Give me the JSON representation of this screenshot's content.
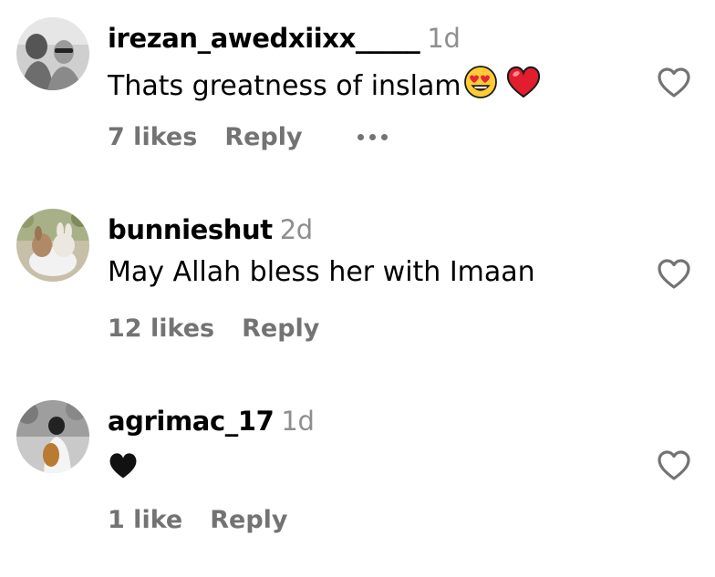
{
  "comments": [
    {
      "username": "irezan_awedxiixx_____",
      "age": "1d",
      "text": "Thats greatness of inslam",
      "emojis": [
        "heart-eyes-emoji",
        "red-heart-emoji"
      ],
      "likes": "7 likes",
      "reply": "Reply",
      "has_more_menu": true
    },
    {
      "username": "bunnieshut",
      "age": "2d",
      "text": "May Allah bless her with Imaan",
      "emojis": [],
      "likes": "12 likes",
      "reply": "Reply",
      "has_more_menu": false
    },
    {
      "username": "agrimac_17",
      "age": "1d",
      "text": "",
      "emojis": [
        "black-heart-emoji"
      ],
      "likes": "1 like",
      "reply": "Reply",
      "has_more_menu": false
    }
  ],
  "colors": {
    "meta_gray": "#737373",
    "age_gray": "#8e8e8e",
    "heart_outline": "#737373",
    "red_heart": "#e11d2e"
  }
}
